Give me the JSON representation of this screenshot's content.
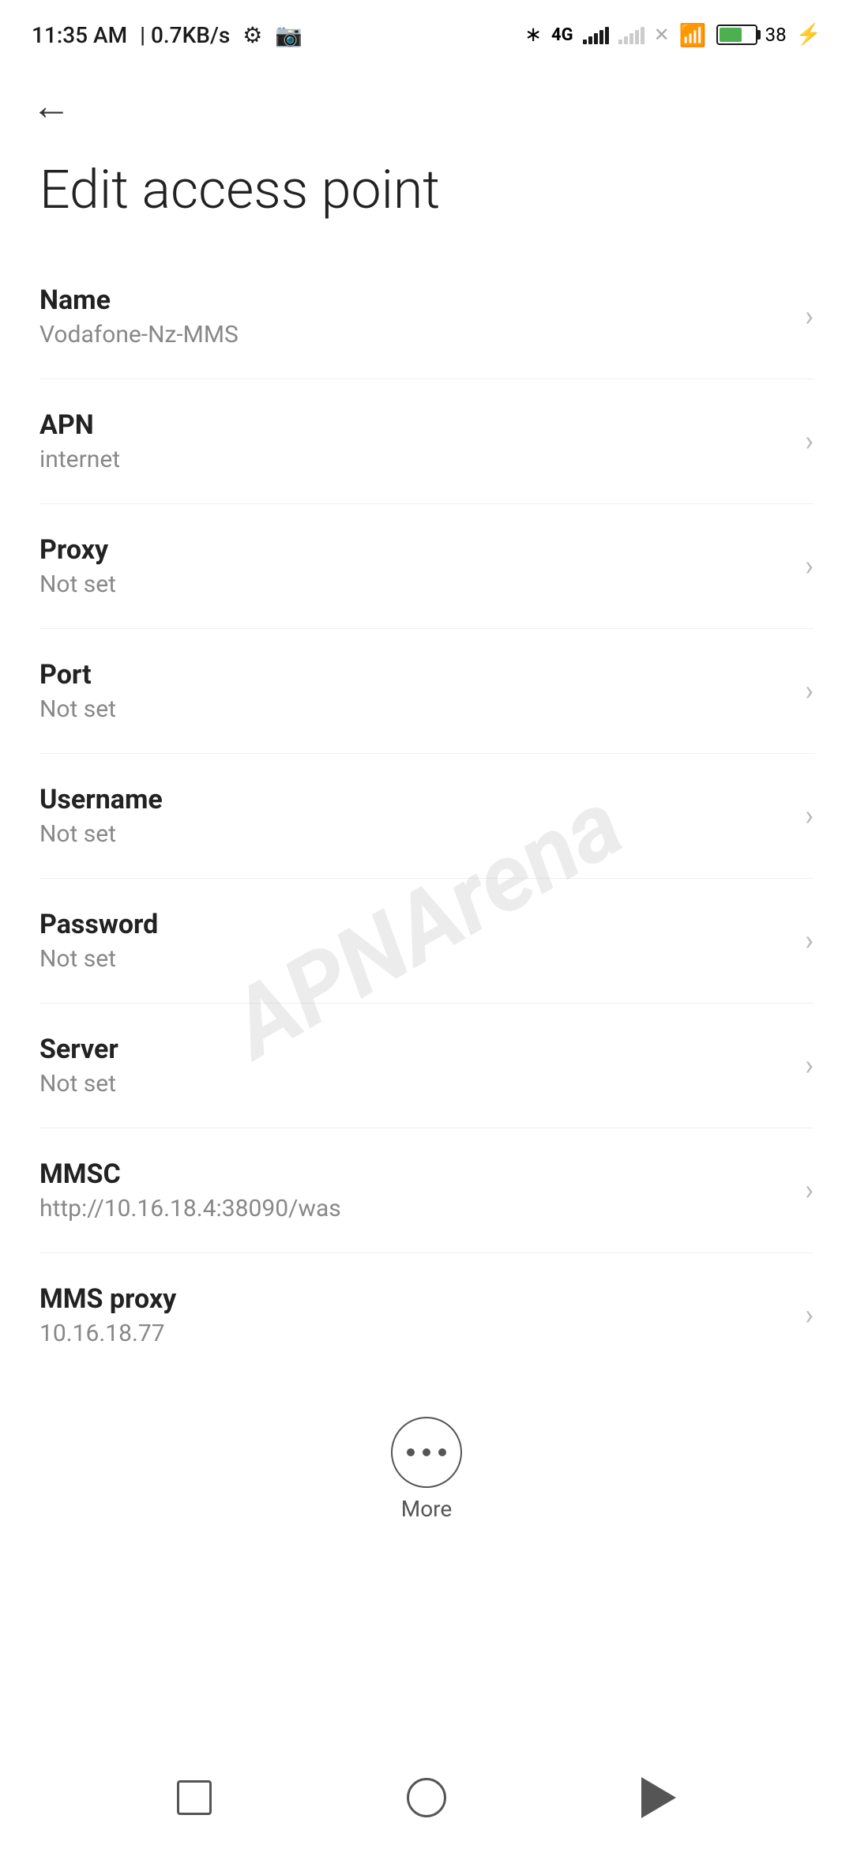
{
  "statusBar": {
    "time": "11:35 AM",
    "speed": "0.7KB/s",
    "batteryPercent": "38"
  },
  "navigation": {
    "backLabel": "←"
  },
  "page": {
    "title": "Edit access point"
  },
  "settings": [
    {
      "id": "name",
      "label": "Name",
      "value": "Vodafone-Nz-MMS"
    },
    {
      "id": "apn",
      "label": "APN",
      "value": "internet"
    },
    {
      "id": "proxy",
      "label": "Proxy",
      "value": "Not set"
    },
    {
      "id": "port",
      "label": "Port",
      "value": "Not set"
    },
    {
      "id": "username",
      "label": "Username",
      "value": "Not set"
    },
    {
      "id": "password",
      "label": "Password",
      "value": "Not set"
    },
    {
      "id": "server",
      "label": "Server",
      "value": "Not set"
    },
    {
      "id": "mmsc",
      "label": "MMSC",
      "value": "http://10.16.18.4:38090/was"
    },
    {
      "id": "mms-proxy",
      "label": "MMS proxy",
      "value": "10.16.18.77"
    }
  ],
  "more": {
    "label": "More"
  },
  "watermark": "APNArena"
}
